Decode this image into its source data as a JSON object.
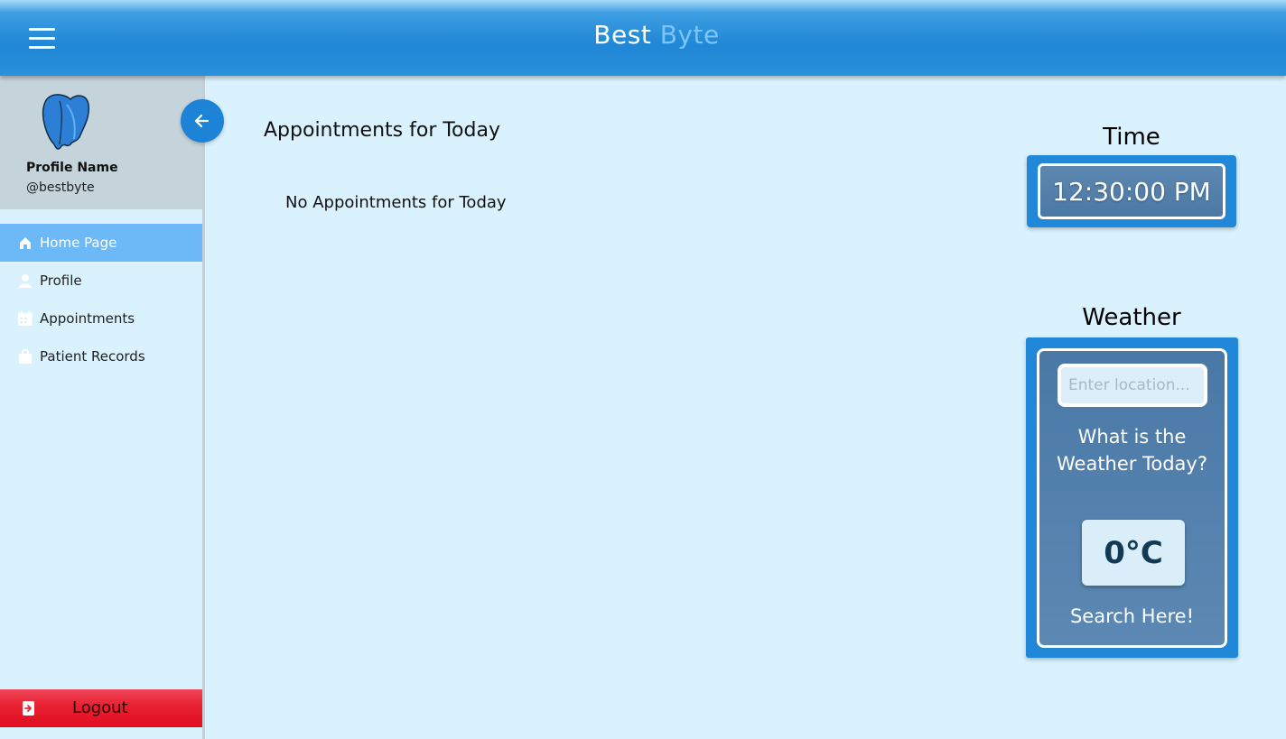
{
  "header": {
    "brand_part1": "Best",
    "brand_part2": "Byte",
    "menu_icon": "hamburger-menu-icon",
    "brand_color": "#7cc5f6",
    "header_color": "#1f87d6"
  },
  "sidebar": {
    "profile": {
      "name": "Profile Name",
      "handle": "@bestbyte",
      "logo_icon": "tooth-icon"
    },
    "back_icon": "arrow-left-icon",
    "items": [
      {
        "label": "Home Page",
        "icon": "home-icon",
        "active": true
      },
      {
        "label": "Profile",
        "icon": "user-icon",
        "active": false
      },
      {
        "label": "Appointments",
        "icon": "calendar-icon",
        "active": false
      },
      {
        "label": "Patient Records",
        "icon": "bag-icon",
        "active": false
      }
    ],
    "logout": {
      "label": "Logout",
      "icon": "logout-icon",
      "color": "#e8202f"
    }
  },
  "main": {
    "title": "Appointments for Today",
    "empty_message": "No Appointments for Today"
  },
  "time_widget": {
    "title": "Time",
    "value": "12:30:00 PM"
  },
  "weather_widget": {
    "title": "Weather",
    "input_placeholder": "Enter location...",
    "question": "What is the Weather Today?",
    "temperature": "0°C",
    "search_label": "Search Here!"
  }
}
